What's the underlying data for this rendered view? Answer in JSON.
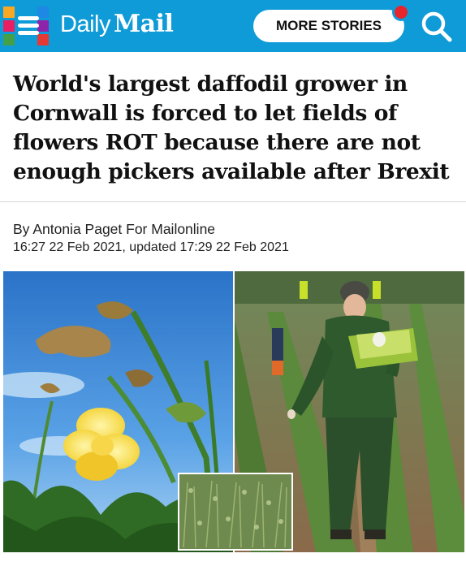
{
  "header": {
    "logo_daily": "Daily",
    "logo_mail": "Mail",
    "more_stories_label": "MORE STORIES",
    "menu_tile_colors": [
      "#f9a825",
      "#e91e63",
      "#43a047",
      "#1e88e5",
      "#8e24aa",
      "#e53935"
    ]
  },
  "article": {
    "headline": "World's largest daffodil grower in Cornwall is forced to let fields of flowers ROT because there are not enough pickers available after Brexit",
    "byline": "By Antonia Paget For Mailonline",
    "dateline": "16:27 22 Feb 2021, updated 17:29 22 Feb 2021"
  },
  "images": {
    "left": "wilted-daffodil-photo",
    "right": "picker-in-field-photo",
    "inset": "field-of-rotting-flowers-photo"
  },
  "colors": {
    "brand_blue": "#0f9bd7",
    "notification_red": "#e8252c"
  }
}
